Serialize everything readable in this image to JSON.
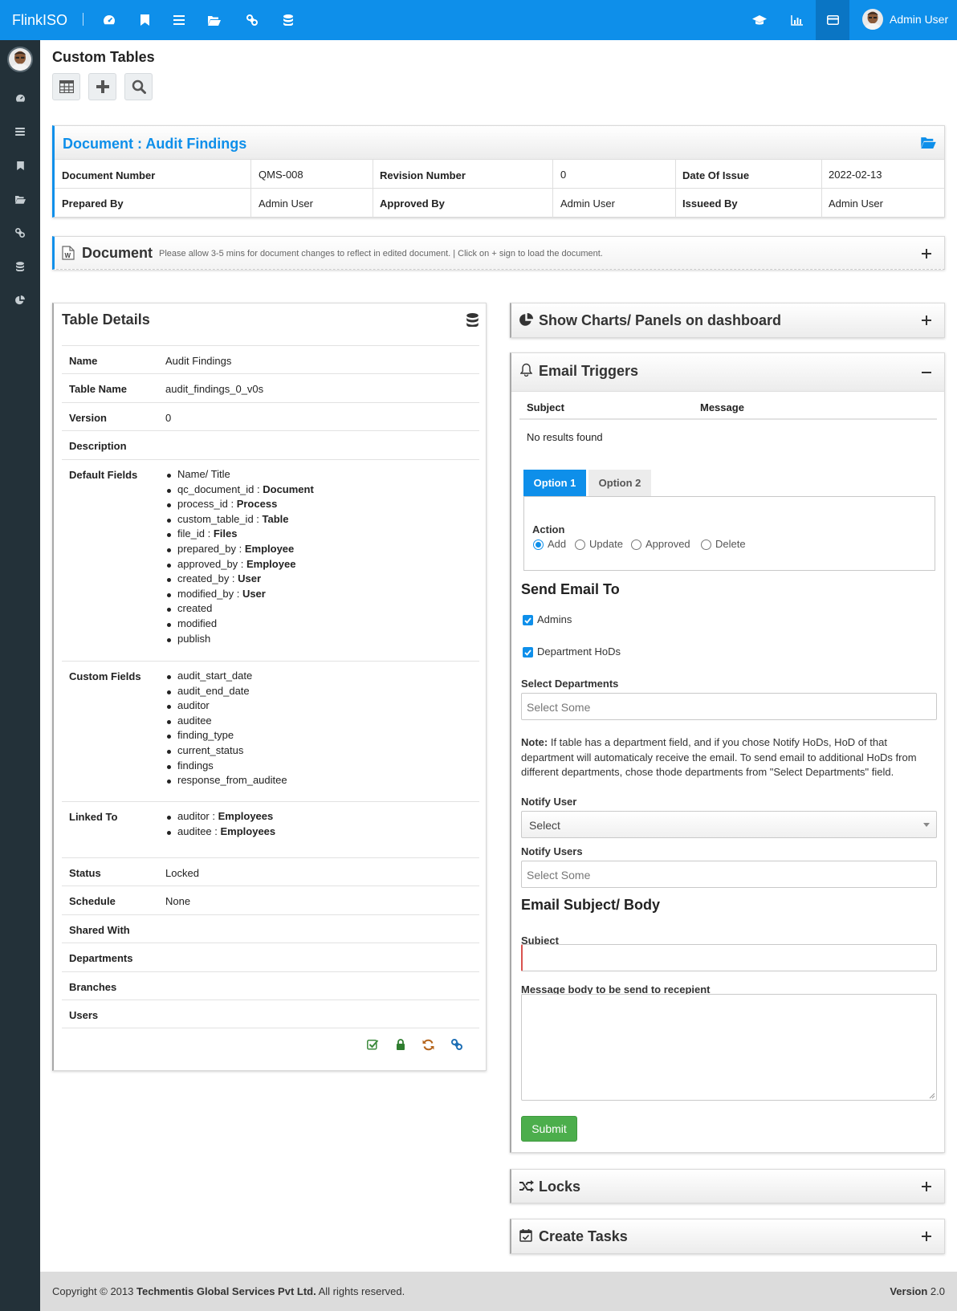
{
  "app": {
    "brand": "FlinkISO",
    "user_name": "Admin User"
  },
  "page": {
    "title": "Custom Tables"
  },
  "document": {
    "header": "Document : Audit Findings",
    "rows": [
      [
        {
          "label": "Document Number",
          "value": "QMS-008"
        },
        {
          "label": "Revision Number",
          "value": "0"
        },
        {
          "label": "Date Of Issue",
          "value": "2022-02-13"
        }
      ],
      [
        {
          "label": "Prepared By",
          "value": "Admin User"
        },
        {
          "label": "Approved By",
          "value": "Admin User"
        },
        {
          "label": "Issueed By",
          "value": "Admin User"
        }
      ]
    ]
  },
  "doc_bar": {
    "title": "Document",
    "note": "Please allow 3-5 mins for document changes to reflect in edited document. | Click on + sign to load the document."
  },
  "table_details": {
    "title": "Table Details",
    "name_label": "Name",
    "name": "Audit Findings",
    "table_name_label": "Table Name",
    "table_name": "audit_findings_0_v0s",
    "version_label": "Version",
    "version": "0",
    "description_label": "Description",
    "default_fields_label": "Default Fields",
    "default_fields": [
      {
        "name": "Name/ Title",
        "type": ""
      },
      {
        "name": "qc_document_id : ",
        "type": "Document"
      },
      {
        "name": "process_id : ",
        "type": "Process"
      },
      {
        "name": "custom_table_id : ",
        "type": "Table"
      },
      {
        "name": "file_id : ",
        "type": "Files"
      },
      {
        "name": "prepared_by : ",
        "type": "Employee"
      },
      {
        "name": "approved_by : ",
        "type": "Employee"
      },
      {
        "name": "created_by : ",
        "type": "User"
      },
      {
        "name": "modified_by : ",
        "type": "User"
      },
      {
        "name": "created",
        "type": ""
      },
      {
        "name": "modified",
        "type": ""
      },
      {
        "name": "publish",
        "type": ""
      }
    ],
    "custom_fields_label": "Custom Fields",
    "custom_fields": [
      "audit_start_date",
      "audit_end_date",
      "auditor",
      "auditee",
      "finding_type",
      "current_status",
      "findings",
      "response_from_auditee"
    ],
    "linked_to_label": "Linked To",
    "linked_to": [
      {
        "name": "auditor : ",
        "type": "Employees"
      },
      {
        "name": "auditee : ",
        "type": "Employees"
      }
    ],
    "status_label": "Status",
    "status": "Locked",
    "schedule_label": "Schedule",
    "schedule": "None",
    "shared_with_label": "Shared With",
    "departments_label": "Departments",
    "branches_label": "Branches",
    "users_label": "Users"
  },
  "charts_panel": {
    "title": "Show Charts/ Panels on dashboard"
  },
  "email_triggers": {
    "title": "Email Triggers",
    "columns": [
      "Subject",
      "Message"
    ],
    "empty": "No results found",
    "tabs": [
      "Option 1",
      "Option 2"
    ],
    "action_label": "Action",
    "actions": [
      "Add",
      "Update",
      "Approved",
      "Delete"
    ],
    "selected_action": "Add",
    "send_to_title": "Send Email To",
    "admins_label": "Admins",
    "admins_checked": true,
    "hods_label": "Department HoDs",
    "hods_checked": true,
    "select_departments_label": "Select Departments",
    "select_departments_placeholder": "Select Some",
    "note_label": "Note:",
    "note_text": " If table has a department field, and if you chose Notify HoDs, HoD of that department will automaticaly receive the email. To send email to additional HoDs from different departments, chose thode departments from \"Select Departments\" field.",
    "notify_user_label": "Notify User",
    "notify_user_value": "Select",
    "notify_users_label": "Notify Users",
    "notify_users_placeholder": "Select Some",
    "subject_body_title": "Email Subject/ Body",
    "subject_label": "Subject",
    "subject_value": "",
    "message_label": "Message body to be send to recepient",
    "message_value": "",
    "submit": "Submit"
  },
  "locks_panel": {
    "title": "Locks"
  },
  "tasks_panel": {
    "title": "Create Tasks"
  },
  "footer": {
    "prefix": "Copyright © 2013 ",
    "company": "Techmentis Global Services Pvt Ltd.",
    "suffix": " All rights reserved.",
    "version_label": "Version",
    "version": " 2.0"
  },
  "colors": {
    "primary": "#0e8fea",
    "sidebar": "#233139",
    "submit": "#4cae4c"
  },
  "icons": {
    "top_nav": [
      "dashboard-icon",
      "bookmark-icon",
      "list-icon",
      "folder-open-icon",
      "link-icon",
      "database-icon"
    ],
    "top_right": [
      "graduation-cap-icon",
      "bar-chart-icon",
      "credit-card-icon"
    ],
    "sidebar": [
      "dashboard-icon",
      "list-icon",
      "bookmark-icon",
      "folder-open-icon",
      "link-icon",
      "database-icon",
      "pie-chart-icon"
    ],
    "toolbar": [
      "table-icon",
      "plus-icon",
      "search-icon"
    ],
    "table_footer": [
      "check-icon",
      "lock-icon",
      "refresh-icon",
      "link-icon"
    ]
  }
}
